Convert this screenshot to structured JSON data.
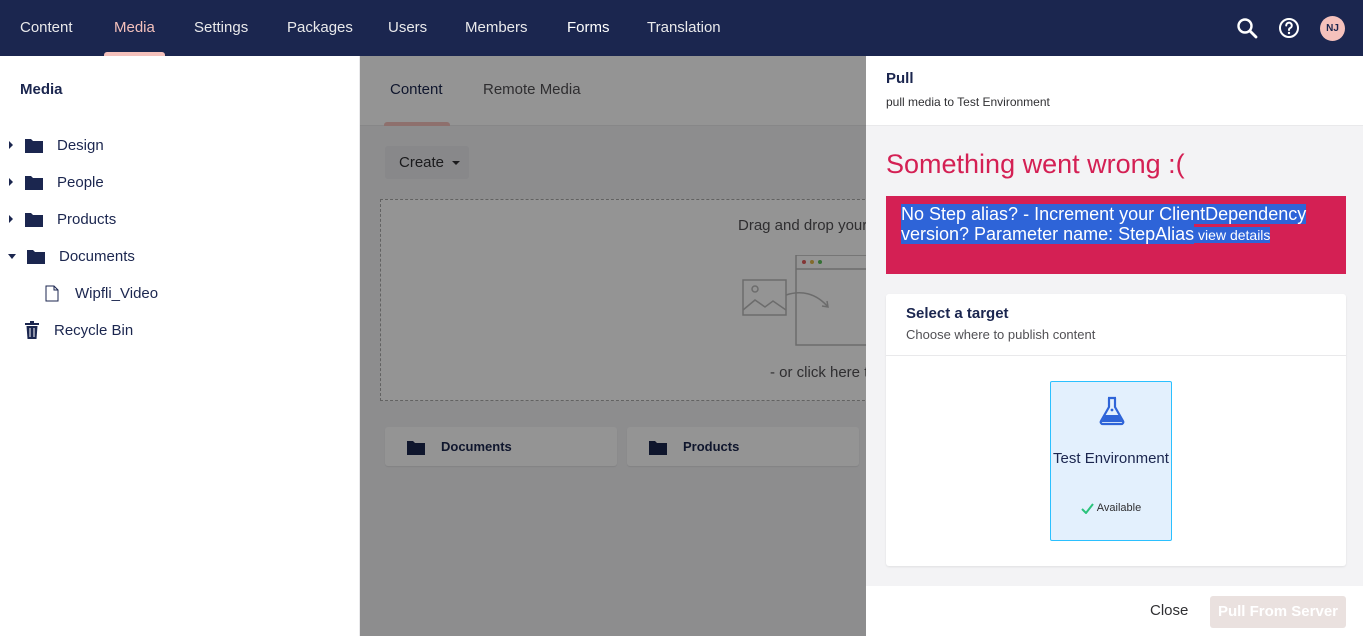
{
  "nav": {
    "items": [
      "Content",
      "Media",
      "Settings",
      "Packages",
      "Users",
      "Members",
      "Forms",
      "Translation"
    ],
    "active": "Media",
    "avatar_initials": "NJ",
    "search_icon": "search-icon",
    "help_icon": "help-icon"
  },
  "tree": {
    "title": "Media",
    "items": [
      {
        "label": "Design",
        "icon": "folder-icon",
        "expand": "collapsed"
      },
      {
        "label": "People",
        "icon": "folder-icon",
        "expand": "collapsed"
      },
      {
        "label": "Products",
        "icon": "folder-icon",
        "expand": "collapsed"
      },
      {
        "label": "Documents",
        "icon": "folder-icon",
        "expand": "expanded"
      },
      {
        "label": "Wipfli_Video",
        "icon": "document-icon",
        "expand": "none"
      },
      {
        "label": "Recycle Bin",
        "icon": "trash-icon",
        "expand": "none"
      }
    ]
  },
  "main": {
    "tabs": [
      "Content",
      "Remote Media"
    ],
    "active_tab": "Content",
    "create_label": "Create",
    "drop_text": "Drag and drop your",
    "drop_click_text": "- or click here t",
    "folders": [
      "Documents",
      "Products"
    ]
  },
  "panel": {
    "title": "Pull",
    "subtitle": "pull media to Test Environment",
    "error_title": "Something went wrong :(",
    "error_message": "No Step alias? - Increment your ClientDependency version? Parameter name: StepAlias",
    "error_link": "view details",
    "target": {
      "title": "Select a target",
      "subtitle": "Choose where to publish content",
      "environment_name": "Test Environment",
      "environment_status": "Available",
      "environment_icon": "flask-icon"
    },
    "close_label": "Close",
    "pull_label": "Pull From Server"
  },
  "colors": {
    "nav_bg": "#1b264f",
    "accent": "#f5c1bc",
    "error": "#d42054",
    "selection": "#2e64d8",
    "tile_bg": "#e3f0fd",
    "tile_border": "#2bc0ff",
    "success": "#2bc37c"
  }
}
